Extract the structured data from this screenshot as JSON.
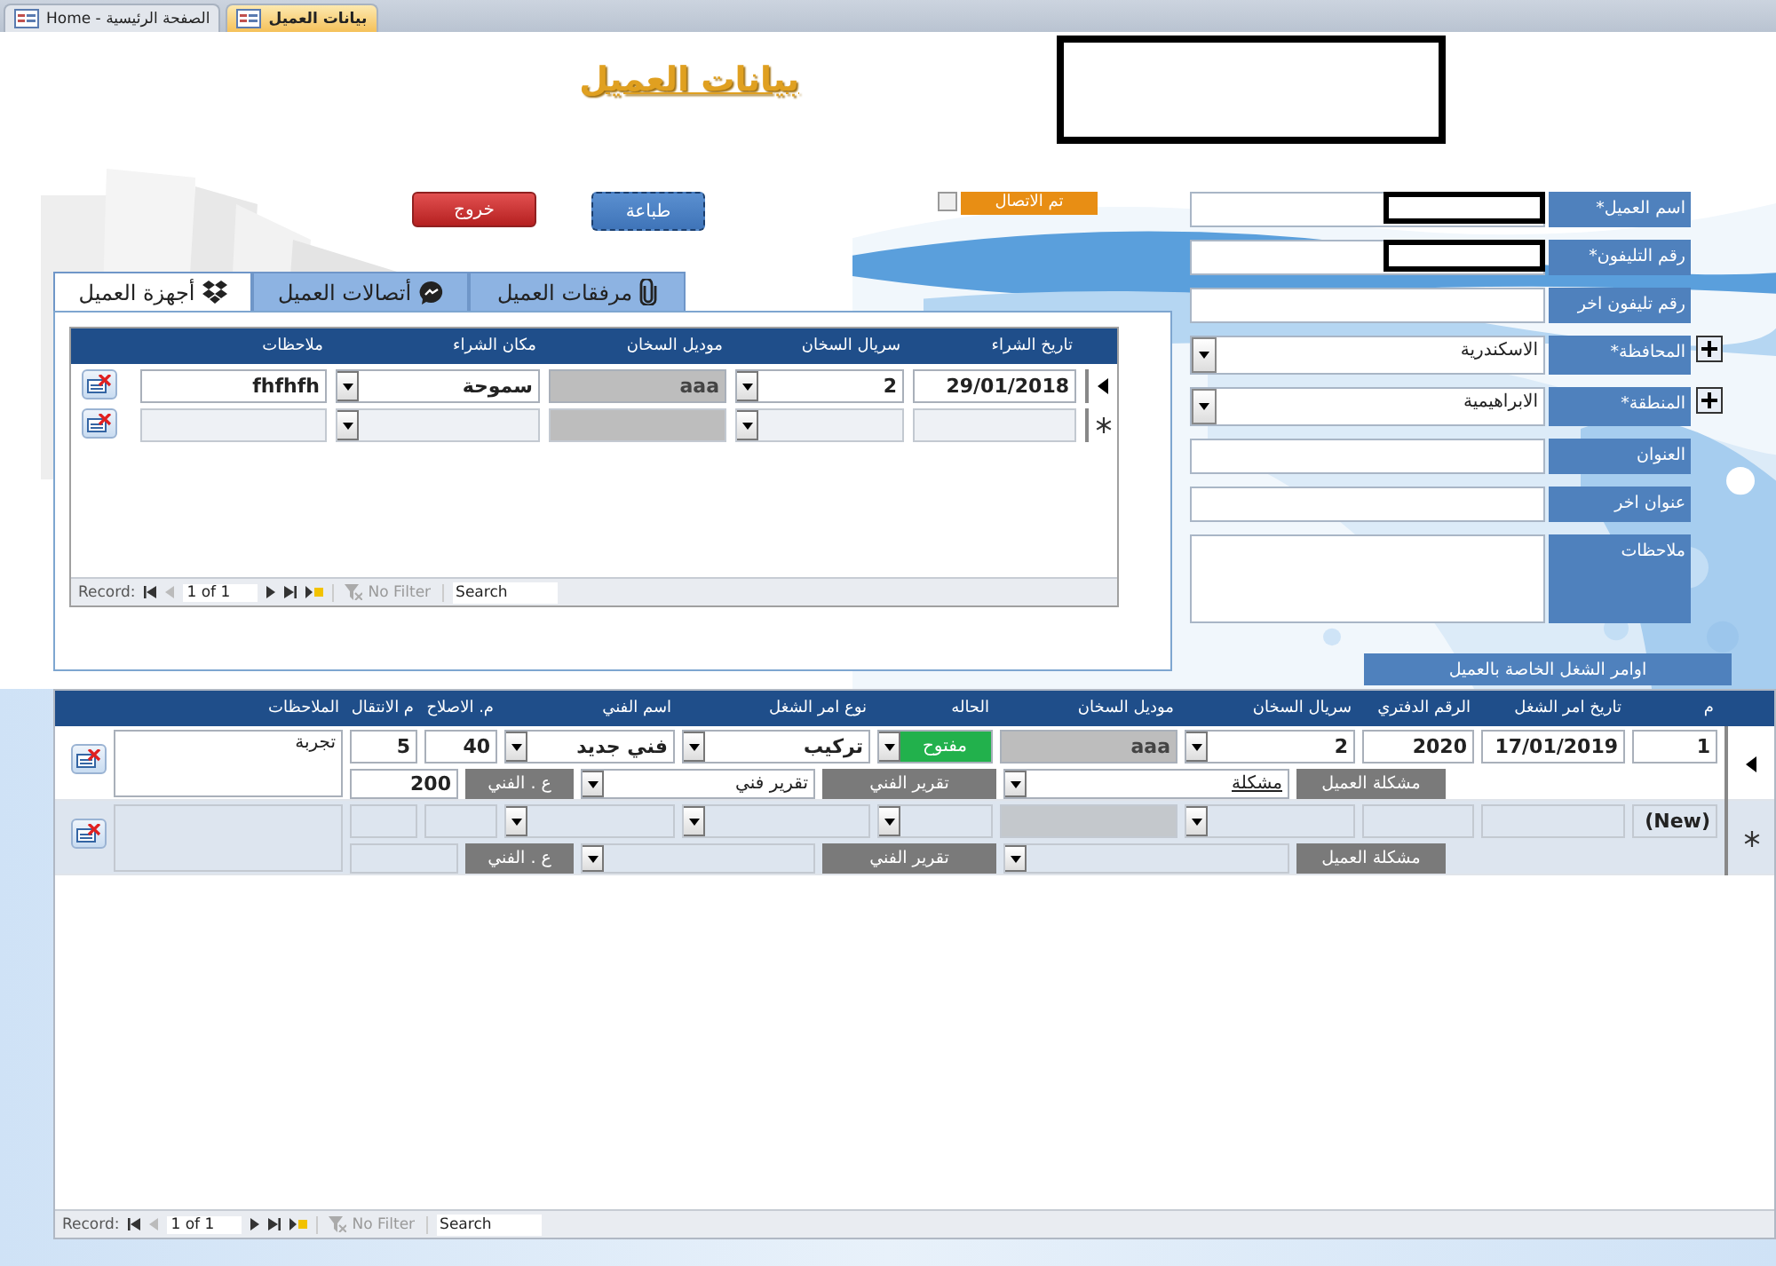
{
  "doc_tabs": [
    {
      "label": "بيانات العميل",
      "selected": true
    },
    {
      "label": "الصفحة الرئيسية - Home",
      "selected": false
    }
  ],
  "title": "بيانات العميل",
  "buttons": {
    "exit": "خروج",
    "print": "طباعة"
  },
  "contacted": {
    "label": "تم الاتصال",
    "checked": false
  },
  "device_tabs": [
    {
      "label": "مرفقات العميل",
      "selected": false
    },
    {
      "label": "أتصالات العميل",
      "selected": false
    },
    {
      "label": "أجهزة العميل",
      "selected": true
    }
  ],
  "devices": {
    "columns": [
      {
        "label": "تاريخ الشراء",
        "kind": "text"
      },
      {
        "label": "سريال السخان",
        "kind": "combo"
      },
      {
        "label": "موديل السخان",
        "kind": "locked"
      },
      {
        "label": "مكان الشراء",
        "kind": "combo"
      },
      {
        "label": "ملاحظات",
        "kind": "text"
      }
    ],
    "rows": [
      {
        "kind": "record",
        "cells": [
          "29/01/2018",
          "2",
          "aaa",
          "سموحة",
          "fhfhfh"
        ]
      },
      {
        "kind": "new"
      }
    ],
    "nav": {
      "label": "Record:",
      "position": "1 of 1",
      "filter": "No Filter",
      "search_placeholder": "Search"
    }
  },
  "customer_fields": [
    {
      "label": "اسم العميل*",
      "kind": "text",
      "redacted": true
    },
    {
      "label": "رقم التليفون*",
      "kind": "text",
      "redacted": true
    },
    {
      "label": "رقم تليفون اخر",
      "kind": "text"
    },
    {
      "label": "المحافظة*",
      "kind": "combo",
      "value": "الاسكندرية"
    },
    {
      "label": "المنطقة*",
      "kind": "combo",
      "value": "الابراهيمية"
    },
    {
      "label": "العنوان",
      "kind": "text"
    },
    {
      "label": "عنوان اخر",
      "kind": "text"
    },
    {
      "label": "ملاحظات",
      "kind": "memo"
    }
  ],
  "work_orders_button": "اوامر الشغل الخاصة بالعميل",
  "work_orders": {
    "columns": [
      {
        "label": "م",
        "kind": "text"
      },
      {
        "label": "تاريخ امر الشغل",
        "kind": "text"
      },
      {
        "label": "الرقم الدفتري",
        "kind": "text"
      },
      {
        "label": "سريال السخان",
        "kind": "combo"
      },
      {
        "label": "موديل السخان",
        "kind": "locked"
      },
      {
        "label": "الحاله",
        "kind": "status"
      },
      {
        "label": "نوع امر الشغل",
        "kind": "combo"
      },
      {
        "label": "اسم الفني",
        "kind": "combo"
      },
      {
        "label": "م. الاصلاح",
        "kind": "text"
      },
      {
        "label": "م الانتقال",
        "kind": "text"
      },
      {
        "label": "الملاحظات",
        "kind": "memo"
      }
    ],
    "rows": [
      {
        "kind": "record",
        "color": "#22b14c",
        "cells": [
          "1",
          "17/01/2019",
          "2020",
          "2",
          "aaa",
          "مفتوح",
          "تركيب",
          "فني جديد",
          "40",
          "5",
          "تجربة"
        ],
        "problem_label": "مشكلة العميل",
        "problem": "مشكلة",
        "report_label": "تقرير الفني",
        "report": "تقرير فني",
        "tech_label": "ع . الفني",
        "tech_value": "200"
      },
      {
        "kind": "new",
        "cells": [
          "(New)"
        ],
        "problem_label": "مشكلة العميل",
        "report_label": "تقرير الفني",
        "tech_label": "ع . الفني"
      }
    ],
    "nav": {
      "label": "Record:",
      "position": "1 of 1",
      "filter": "No Filter",
      "search_placeholder": "Search"
    }
  }
}
